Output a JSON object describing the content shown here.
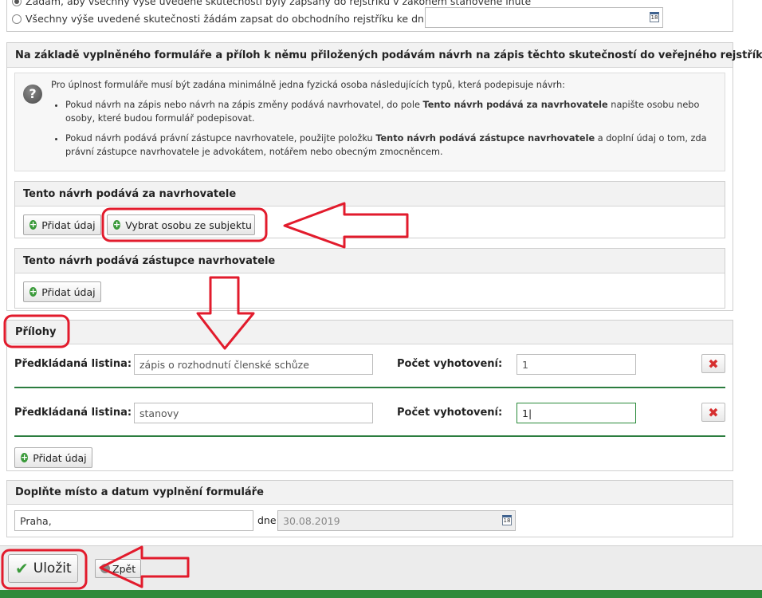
{
  "top": {
    "radio_option_1": "Žádám, aby všechny výše uvedené skutečnosti byly zapsány do rejstříku v zákonem stanovené lhůtě",
    "radio_option_2": "Všechny výše uvedené skutečnosti žádám zapsat do obchodního rejstříku ke dni:",
    "date_value": "",
    "calendar_icon_text": "18"
  },
  "proposal": {
    "title": "Na základě vyplněného formuláře a příloh k němu přiložených podávám návrh na zápis těchto skutečností do veřejného rejstříku.",
    "info_intro": "Pro úplnost formuláře musí být zadána minimálně jedna fyzická osoba následujících typů, která podepisuje návrh:",
    "bullet1_a": "Pokud návrh na zápis nebo návrh na zápis změny podává navrhovatel, do pole ",
    "bullet1_b": "Tento návrh podává za navrhovatele",
    "bullet1_c": " napište osobu nebo osoby, které budou formulář podepisovat.",
    "bullet2_a": "Pokud návrh podává právní zástupce navrhovatele, použijte položku ",
    "bullet2_b": "Tento návrh podává zástupce navrhovatele",
    "bullet2_c": " a doplní údaj o tom, zda právní zástupce navrhovatele je advokátem, notářem nebo obecným zmocněncem.",
    "help_icon_glyph": "?",
    "applicant": {
      "title": "Tento návrh podává za navrhovatele",
      "add_label": "Přidat údaj",
      "select_person_label": "Vybrat osobu ze subjektu"
    },
    "representative": {
      "title": "Tento návrh podává zástupce navrhovatele",
      "add_label": "Přidat údaj"
    }
  },
  "attachments": {
    "title": "Přílohy",
    "rows": [
      {
        "doc_label": "Předkládaná listina:",
        "doc_value": "zápis o rozhodnutí členské schůze",
        "count_label": "Počet vyhotovení:",
        "count_value": "1"
      },
      {
        "doc_label": "Předkládaná listina:",
        "doc_value": "stanovy",
        "count_label": "Počet vyhotovení:",
        "count_value": "1|"
      }
    ],
    "add_label": "Přidat údaj",
    "delete_glyph": "✖"
  },
  "place_date": {
    "title": "Doplňte místo a datum vyplnění formuláře",
    "place_value": "Praha,",
    "date_prefix": "dne",
    "date_value": "30.08.2019"
  },
  "footer": {
    "save_label": "Uložit",
    "back_label": "Zpět"
  },
  "colors": {
    "accent_green": "#2f8a3a",
    "annotation_red": "#e21b2c",
    "delete_red": "#d62f2f"
  }
}
